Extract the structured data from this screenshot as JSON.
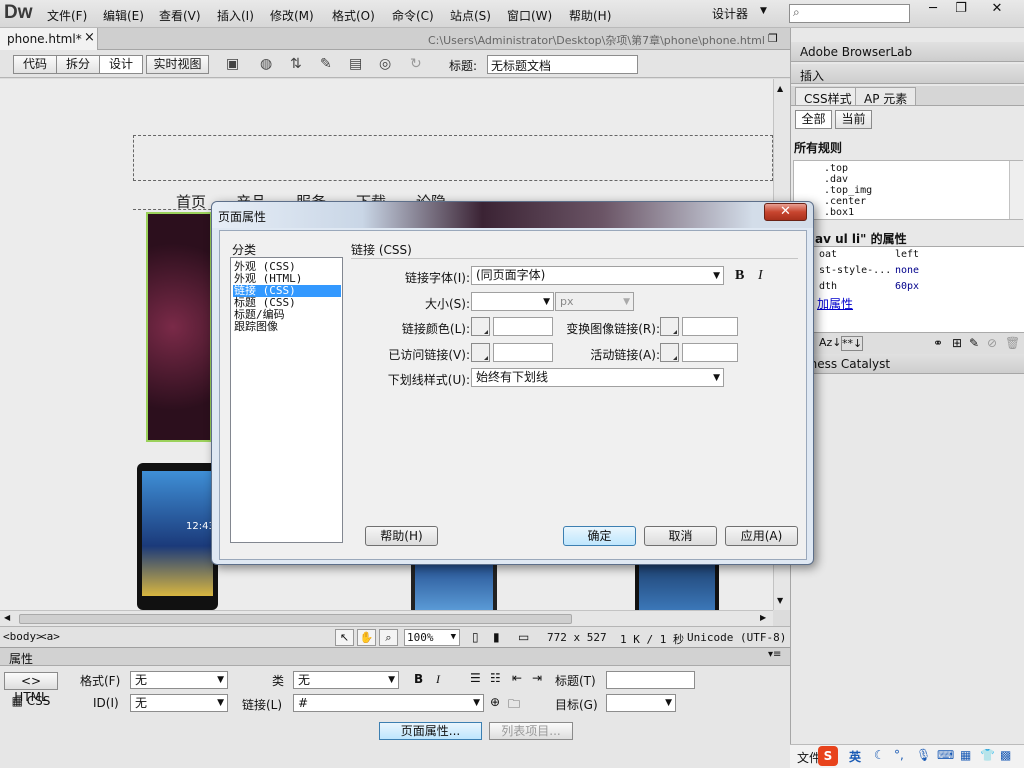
{
  "app": {
    "logo": "Dw",
    "menus": [
      "文件(F)",
      "编辑(E)",
      "查看(V)",
      "插入(I)",
      "修改(M)",
      "格式(O)",
      "命令(C)",
      "站点(S)",
      "窗口(W)",
      "帮助(H)"
    ],
    "workspace": "设计器",
    "window_buttons": [
      "─",
      "❐",
      "✕"
    ]
  },
  "document": {
    "tab_name": "phone.html*",
    "tab_close": "×",
    "path": "C:\\Users\\Administrator\\Desktop\\杂项\\第7章\\phone\\phone.html",
    "views": [
      "代码",
      "拆分",
      "设计",
      "实时视图"
    ],
    "title_label": "标题:",
    "title_value": "无标题文档"
  },
  "design_view": {
    "nav_items": [
      "首页",
      "产品",
      "服务",
      "下载",
      "论隐"
    ],
    "phone_time": "12:43"
  },
  "status_bar": {
    "tags": [
      "<body>",
      "<a>"
    ],
    "zoom": "100%",
    "dimensions": "772 x 527",
    "size_time": "1 K / 1 秒",
    "encoding": "Unicode (UTF-8)"
  },
  "property_inspector": {
    "title": "属性",
    "html_tab": "HTML",
    "css_tab": "CSS",
    "format_label": "格式(F)",
    "format_value": "无",
    "id_label": "ID(I)",
    "id_value": "无",
    "class_label": "类",
    "class_value": "无",
    "link_label": "链接(L)",
    "link_value": "#",
    "title_label": "标题(T)",
    "target_label": "目标(G)",
    "page_props_button": "页面属性...",
    "list_item_button": "列表项目..."
  },
  "right_panel": {
    "browserlab": "Adobe BrowserLab",
    "insert": "插入",
    "css_tab": "CSS样式",
    "ap_tab": "AP 元素",
    "all_button": "全部",
    "current_button": "当前",
    "all_rules_label": "所有规则",
    "rules": [
      ".top",
      ".dav",
      ".top_img",
      ".center",
      ".box1"
    ],
    "props_heading": "av ul li\" 的属性",
    "props_rows": [
      {
        "name": "oat",
        "value": "left"
      },
      {
        "name": "st-style-...",
        "value": "none"
      },
      {
        "name": "dth",
        "value": "60px"
      }
    ],
    "add_property": "加属性",
    "business_catalyst": "siness Catalyst",
    "taskbar_text": "文件",
    "ime_label": "英"
  },
  "dialog": {
    "title": "页面属性",
    "close_label": "✕",
    "category_label": "分类",
    "categories": [
      "外观 (CSS)",
      "外观 (HTML)",
      "链接 (CSS)",
      "标题 (CSS)",
      "标题/编码",
      "跟踪图像"
    ],
    "selected_category_index": 2,
    "section_title": "链接 (CSS)",
    "font_label": "链接字体(I):",
    "font_value": "(同页面字体)",
    "bold_label": "B",
    "italic_label": "I",
    "size_label": "大小(S):",
    "size_value": "",
    "size_unit": "px",
    "link_color_label": "链接颜色(L):",
    "rollover_label": "变换图像链接(R):",
    "visited_label": "已访问链接(V):",
    "active_label": "活动链接(A):",
    "underline_label": "下划线样式(U):",
    "underline_value": "始终有下划线",
    "help_button": "帮助(H)",
    "ok_button": "确定",
    "cancel_button": "取消",
    "apply_button": "应用(A)"
  }
}
